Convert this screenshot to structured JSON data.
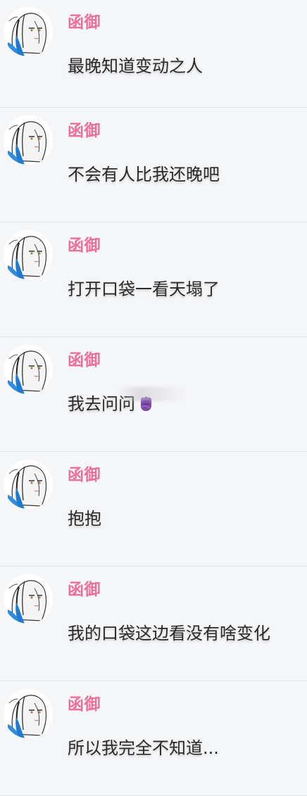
{
  "messages": [
    {
      "name": "函御",
      "text": "最晚知道变动之人"
    },
    {
      "name": "函御",
      "text": "不会有人比我还晚吧"
    },
    {
      "name": "函御",
      "text": "打开口袋一看天塌了"
    },
    {
      "name": "函御",
      "text": "我去问问",
      "emoji": "purple-fist-emoji"
    },
    {
      "name": "函御",
      "text": "抱抱"
    },
    {
      "name": "函御",
      "text": "我的口袋这边看没有啥变化"
    },
    {
      "name": "函御",
      "text": "所以我完全不知道..."
    }
  ],
  "colors": {
    "name": "#ec6f9a",
    "text": "#2a2a2a",
    "background": "#f5f6f8",
    "divider": "#e3e5e8",
    "avatar_accent": "#2e8fe0"
  }
}
